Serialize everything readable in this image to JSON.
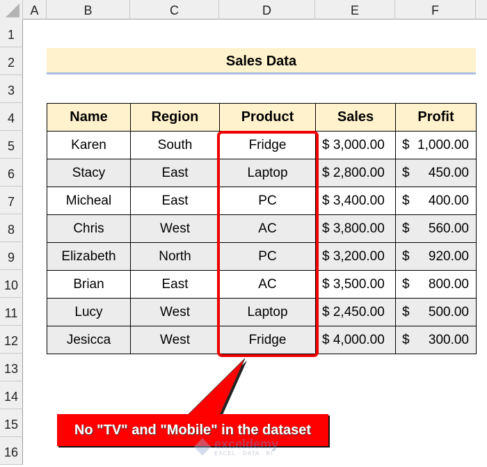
{
  "spreadsheet": {
    "column_headers": [
      "A",
      "B",
      "C",
      "D",
      "E",
      "F"
    ],
    "row_headers": [
      "1",
      "2",
      "3",
      "4",
      "5",
      "6",
      "7",
      "8",
      "9",
      "10",
      "11",
      "12",
      "13",
      "14",
      "15",
      "16"
    ]
  },
  "title": "Sales Data",
  "table": {
    "headers": [
      "Name",
      "Region",
      "Product",
      "Sales",
      "Profit"
    ],
    "rows": [
      {
        "name": "Karen",
        "region": "South",
        "product": "Fridge",
        "sales": "$ 3,000.00",
        "profit_symbol": "$",
        "profit_value": "1,000.00",
        "shade": "white"
      },
      {
        "name": "Stacy",
        "region": "East",
        "product": "Laptop",
        "sales": "$ 2,800.00",
        "profit_symbol": "$",
        "profit_value": "450.00",
        "shade": "gray"
      },
      {
        "name": "Micheal",
        "region": "East",
        "product": "PC",
        "sales": "$ 3,400.00",
        "profit_symbol": "$",
        "profit_value": "400.00",
        "shade": "white"
      },
      {
        "name": "Chris",
        "region": "West",
        "product": "AC",
        "sales": "$ 3,800.00",
        "profit_symbol": "$",
        "profit_value": "560.00",
        "shade": "gray"
      },
      {
        "name": "Elizabeth",
        "region": "North",
        "product": "PC",
        "sales": "$ 3,200.00",
        "profit_symbol": "$",
        "profit_value": "920.00",
        "shade": "gray"
      },
      {
        "name": "Brian",
        "region": "East",
        "product": "AC",
        "sales": "$ 3,500.00",
        "profit_symbol": "$",
        "profit_value": "800.00",
        "shade": "white"
      },
      {
        "name": "Lucy",
        "region": "West",
        "product": "Laptop",
        "sales": "$ 2,450.00",
        "profit_symbol": "$",
        "profit_value": "500.00",
        "shade": "gray"
      },
      {
        "name": "Jesicca",
        "region": "West",
        "product": "Fridge",
        "sales": "$ 4,000.00",
        "profit_symbol": "$",
        "profit_value": "300.00",
        "shade": "gray"
      }
    ]
  },
  "callout": {
    "text": "No \"TV\" and \"Mobile\" in the dataset",
    "color": "#ff0000"
  },
  "highlight": {
    "color": "#ee0000",
    "column": "Product"
  },
  "watermark": {
    "main": "exceldemy",
    "sub": "EXCEL · DATA · BI"
  },
  "colors": {
    "header_fill": "#fff2cc",
    "alt_row_fill": "#ececec",
    "title_underline": "#a9bde0"
  }
}
